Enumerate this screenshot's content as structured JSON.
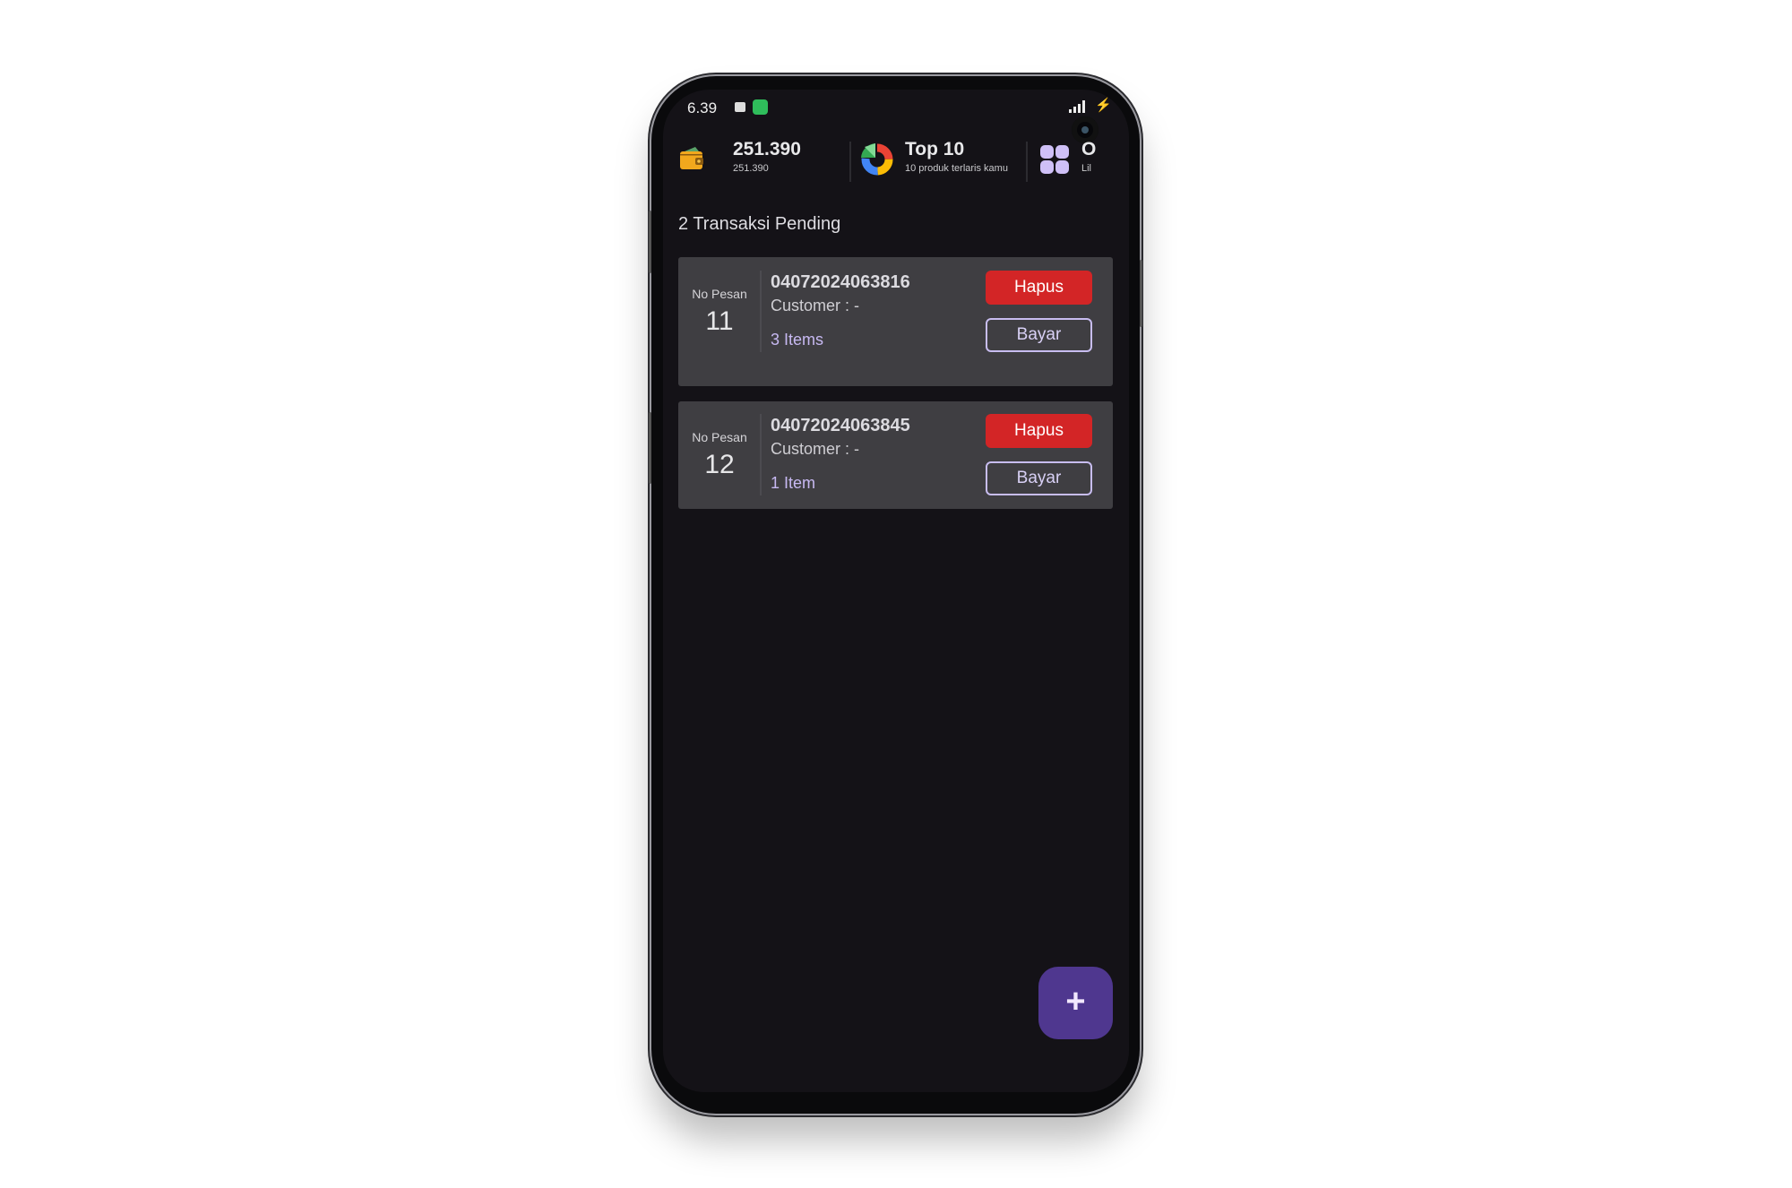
{
  "status_bar": {
    "time": "6.39",
    "icons": [
      "lock-icon",
      "shield-icon",
      "signal-icon",
      "charging-icon"
    ]
  },
  "header": {
    "balance": {
      "value": "251.390",
      "sub": "251.390",
      "icon": "wallet-icon"
    },
    "top": {
      "title": "Top 10",
      "sub": "10 produk terlaris kamu",
      "icon": "pie-chart-icon"
    },
    "more": {
      "title": "O",
      "sub": "Lil",
      "icon": "grid-icon"
    }
  },
  "pending_title": "2 Transaksi Pending",
  "transactions": [
    {
      "label": "No Pesan",
      "number": "11",
      "order_no": "04072024063816",
      "customer": "Customer : -",
      "items": "3 Items",
      "delete_label": "Hapus",
      "pay_label": "Bayar"
    },
    {
      "label": "No Pesan",
      "number": "12",
      "order_no": "04072024063845",
      "customer": "Customer : -",
      "items": "1 Item",
      "delete_label": "Hapus",
      "pay_label": "Bayar"
    }
  ],
  "fab": {
    "label": "+",
    "icon": "plus-icon"
  },
  "colors": {
    "background": "#141217",
    "card": "#3f3e42",
    "delete": "#d32526",
    "accent": "#4f378f",
    "items_text": "#c7b9f2"
  }
}
